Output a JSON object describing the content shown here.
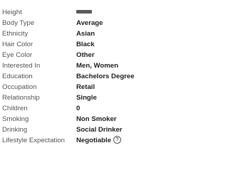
{
  "profile_details": {
    "rows": [
      {
        "label": "Height",
        "value": ""
      },
      {
        "label": "Body Type",
        "value": "Average"
      },
      {
        "label": "Ethnicity",
        "value": "Asian"
      },
      {
        "label": "Hair Color",
        "value": "Black"
      },
      {
        "label": "Eye Color",
        "value": "Other"
      },
      {
        "label": "Interested In",
        "value": "Men, Women"
      },
      {
        "label": "Education",
        "value": "Bachelors Degree"
      },
      {
        "label": "Occupation",
        "value": "Retail"
      },
      {
        "label": "Relationship",
        "value": "Single"
      },
      {
        "label": "Children",
        "value": "0"
      },
      {
        "label": "Smoking",
        "value": "Non Smoker"
      },
      {
        "label": "Drinking",
        "value": "Social Drinker"
      },
      {
        "label": "Lifestyle Expectation",
        "value": "Negotiable"
      }
    ],
    "help_icon": {
      "icon": "question-circle-icon",
      "glyph": "?"
    }
  }
}
